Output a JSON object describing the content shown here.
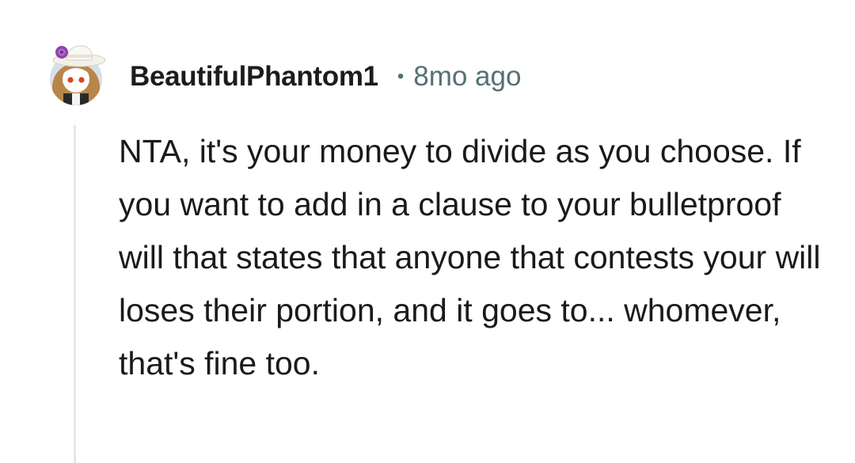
{
  "comment": {
    "author": "BeautifulPhantom1",
    "separator": "•",
    "timestamp": "8mo ago",
    "avatar_icon": "snoo-avatar-icon",
    "body": "NTA, it's your money to divide as you choose. If you want to add in a clause to your bulletproof will that states that anyone that contests your will loses their portion, and it goes to... whomever, that's fine too."
  },
  "colors": {
    "author": "#1c1c1c",
    "meta": "#576f76",
    "body": "#1a1a1b",
    "thread_line": "#e5e8ea",
    "background": "#ffffff"
  }
}
